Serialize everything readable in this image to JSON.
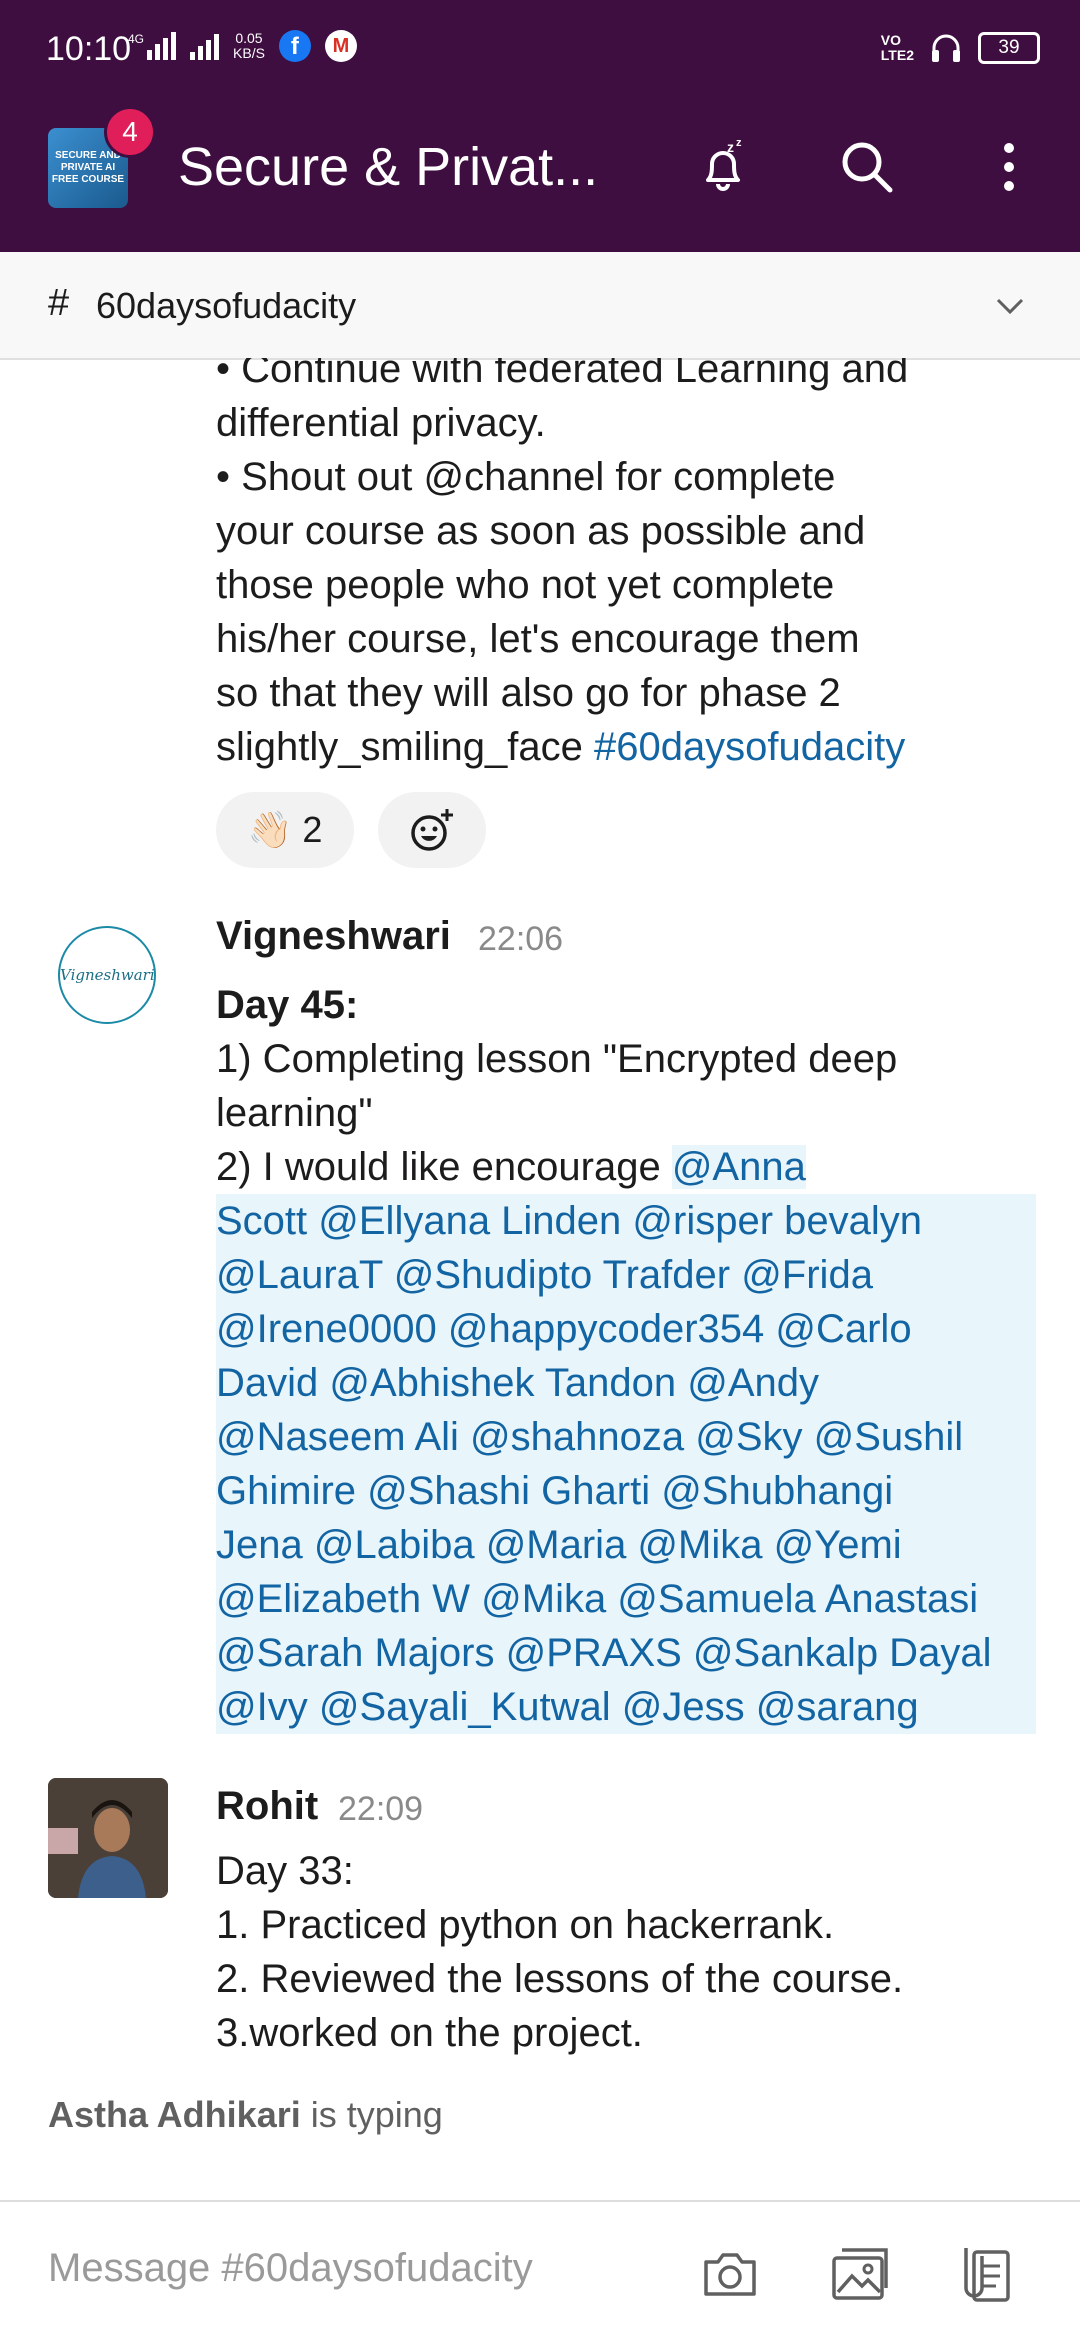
{
  "status_bar": {
    "time": "10:10",
    "network": "4G",
    "speed_value": "0.05",
    "speed_unit": "KB/S",
    "volte_top": "VO",
    "volte_bottom": "LTE2",
    "battery": "39"
  },
  "header": {
    "workspace_icon_text": "SECURE AND PRIVATE AI FREE COURSE",
    "notification_count": "4",
    "workspace_title": "Secure & Privat..."
  },
  "channel": {
    "hash": "#",
    "name": "60daysofudacity"
  },
  "messages": [
    {
      "lines": [
        "• Continue with federated Learning and",
        "differential privacy.",
        "•  Shout out @channel for complete",
        "your course as soon as possible and",
        "those people who not yet complete",
        "his/her course, let's encourage them",
        "so that they will also go for phase 2"
      ],
      "last_line_text": "slightly_smiling_face ",
      "last_line_hashtag": "#60daysofudacity",
      "reaction_emoji": "👋🏻",
      "reaction_count": "2"
    },
    {
      "author": "Vigneshwari",
      "time": "22:06",
      "avatar_text": "Vigneshwari",
      "title": "Day 45:",
      "lines": [
        "1) Completing lesson \"Encrypted deep",
        "learning\""
      ],
      "mention_intro": "2) I would like encourage  ",
      "mentions_first": "@Anna",
      "mention_lines": [
        "Scott @Ellyana Linden @risper bevalyn",
        " @LauraT @Shudipto Trafder  @Frida",
        "@Irene0000 @happycoder354 @Carlo",
        "David @Abhishek Tandon @Andy",
        "@Naseem Ali @shahnoza @Sky @Sushil",
        "Ghimire @Shashi Gharti @Shubhangi",
        "Jena @Labiba @Maria @Mika @Yemi",
        "@Elizabeth W @Mika @Samuela Anastasi",
        "@Sarah Majors @PRAXS @Sankalp Dayal",
        "@Ivy @Sayali_Kutwal @Jess @sarang"
      ]
    },
    {
      "author": "Rohit",
      "time": "22:09",
      "lines": [
        "Day 33:",
        "1. Practiced python on hackerrank.",
        "2. Reviewed the lessons of the course.",
        "3.worked on the project."
      ]
    }
  ],
  "typing": {
    "name": "Astha Adhikari",
    "suffix": " is typing"
  },
  "composer": {
    "placeholder": "Message #60daysofudacity"
  },
  "icons": {
    "snooze": "snooze-bell-icon",
    "search": "search-icon",
    "more": "more-vertical-icon",
    "camera": "camera-icon",
    "gallery": "gallery-icon",
    "files": "files-icon",
    "add_reaction": "add-reaction-icon"
  },
  "colors": {
    "brand": "#3f0e40",
    "link": "#1264a3",
    "badge": "#e01e5a"
  }
}
